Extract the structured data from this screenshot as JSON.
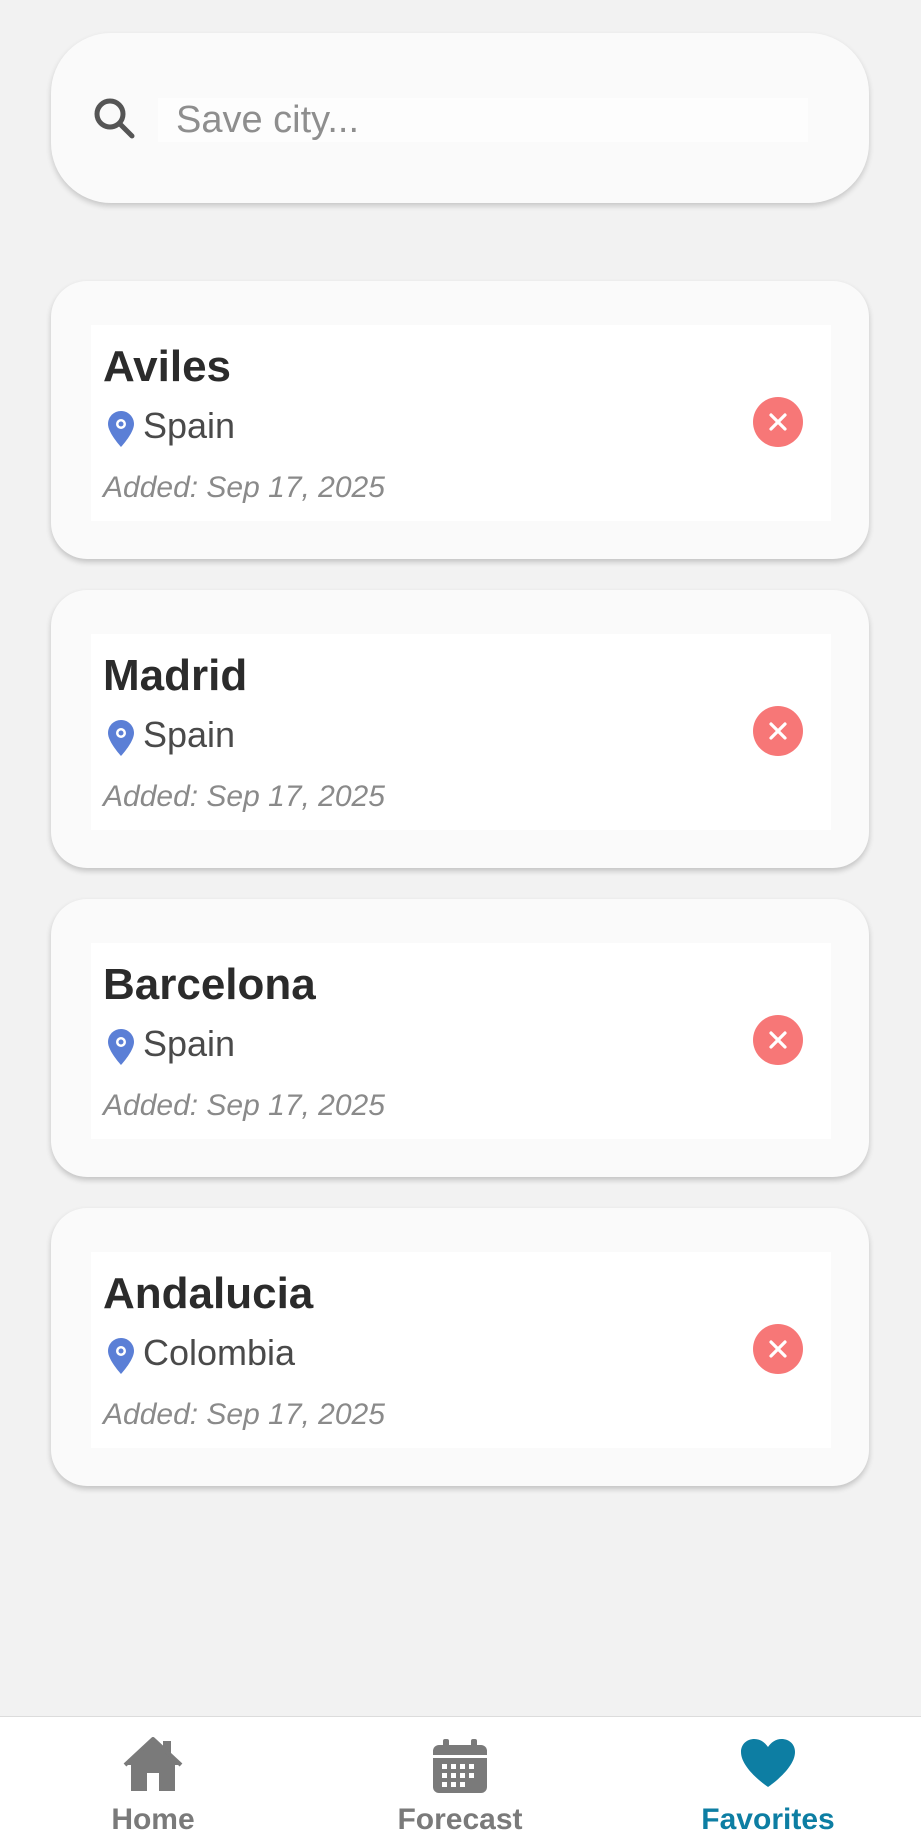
{
  "search": {
    "placeholder": "Save city...",
    "value": ""
  },
  "favorites": [
    {
      "city": "Aviles",
      "country": "Spain",
      "added": "Added: Sep 17, 2025"
    },
    {
      "city": "Madrid",
      "country": "Spain",
      "added": "Added: Sep 17, 2025"
    },
    {
      "city": "Barcelona",
      "country": "Spain",
      "added": "Added: Sep 17, 2025"
    },
    {
      "city": "Andalucia",
      "country": "Colombia",
      "added": "Added: Sep 17, 2025"
    }
  ],
  "icons": {
    "search": "search-icon",
    "pin": "location-pin-icon",
    "remove": "close-circle-icon",
    "home": "home-icon",
    "forecast": "calendar-icon",
    "favorites": "heart-icon"
  },
  "nav": {
    "home_label": "Home",
    "forecast_label": "Forecast",
    "favorites_label": "Favorites",
    "active": "Favorites"
  },
  "colors": {
    "accent": "#0d7ea3",
    "remove": "#f77777",
    "pin": "#5b7fd6",
    "inactive_icon": "#7a7a7a"
  }
}
